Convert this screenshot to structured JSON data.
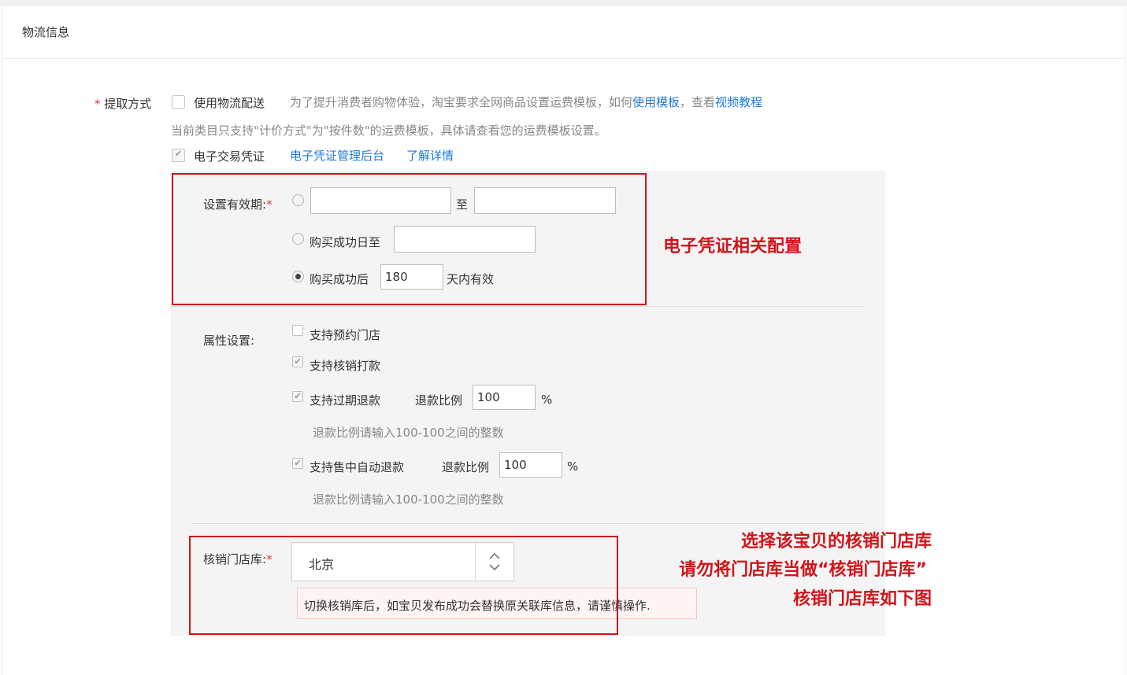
{
  "section": {
    "title": "物流信息"
  },
  "pickup": {
    "label": "提取方式",
    "star": "*",
    "logistics_checkbox_label": "使用物流配送",
    "hint_prefix": "为了提升消费者购物体验，淘宝要求全网商品设置运费模板，如何",
    "hint_link1": "使用模板",
    "hint_middle": "，查看",
    "hint_link2": "视频教程",
    "note": "当前类目只支持\"计价方式\"为\"按件数\"的运费模板，具体请查看您的运费模板设置。",
    "evoucher_label": "电子交易凭证",
    "evoucher_admin_link": "电子凭证管理后台",
    "evoucher_detail_link": "了解详情"
  },
  "validity": {
    "label": "设置有效期:",
    "star": "*",
    "option1": {
      "from_value": "",
      "to_label": "至",
      "to_value": ""
    },
    "option2": {
      "label": "购买成功日至",
      "value": ""
    },
    "option3": {
      "prefix": "购买成功后",
      "value": "180",
      "suffix": "天内有效",
      "selected": true
    }
  },
  "attributes": {
    "label": "属性设置:",
    "reserve_store": {
      "label": "支持预约门店",
      "checked": false
    },
    "verify_pay": {
      "label": "支持核销打款",
      "checked": true
    },
    "expired_refund": {
      "label": "支持过期退款",
      "checked": true,
      "ratio_label": "退款比例",
      "ratio_value": "100",
      "unit": "%",
      "hint": "退款比例请输入100-100之间的整数"
    },
    "auto_refund": {
      "label": "支持售中自动退款",
      "checked": true,
      "ratio_label": "退款比例",
      "ratio_value": "100",
      "unit": "%",
      "hint": "退款比例请输入100-100之间的整数"
    }
  },
  "store_library": {
    "label": "核销门店库:",
    "star": "*",
    "selected": "北京",
    "warning": "切换核销库后，如宝贝发布成功会替换原关联库信息，请谨慎操作."
  },
  "annotations": {
    "evoucher_config": "电子凭证相关配置",
    "line1": "选择该宝贝的核销门店库",
    "line2": "请勿将门店库当做“核销门店库”",
    "line3": "核销门店库如下图"
  },
  "colors": {
    "annotation_red": "#c9161b",
    "link_blue": "#1f7ad8",
    "required_star": "#e4393c"
  },
  "icons": {
    "checkbox_check": "check-icon",
    "select_arrows": "chevron-updown-icon"
  }
}
